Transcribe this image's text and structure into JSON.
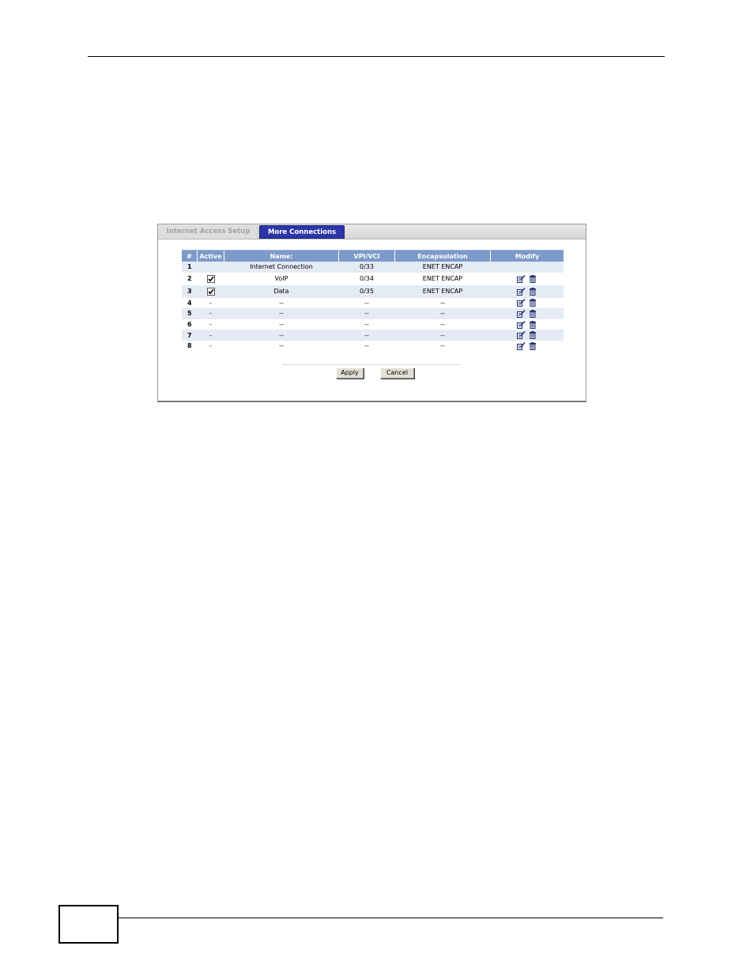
{
  "tabs": [
    {
      "label": "Internet Access Setup",
      "active": false
    },
    {
      "label": "More Connections",
      "active": true
    }
  ],
  "table": {
    "headers": [
      "#",
      "Active",
      "Name:",
      "VPI/VCI",
      "Encapsulation",
      "Modify"
    ],
    "rows": [
      {
        "num": "1",
        "active": "",
        "name": "Internet Connection",
        "vpivci": "0/33",
        "encap": "ENET ENCAP"
      },
      {
        "num": "2",
        "active": "checked",
        "name": "VoIP",
        "vpivci": "0/34",
        "encap": "ENET ENCAP"
      },
      {
        "num": "3",
        "active": "checked",
        "name": "Data",
        "vpivci": "0/35",
        "encap": "ENET ENCAP"
      },
      {
        "num": "4",
        "active": "-",
        "name": "--",
        "vpivci": "--",
        "encap": "--"
      },
      {
        "num": "5",
        "active": "-",
        "name": "--",
        "vpivci": "--",
        "encap": "--"
      },
      {
        "num": "6",
        "active": "-",
        "name": "--",
        "vpivci": "--",
        "encap": "--"
      },
      {
        "num": "7",
        "active": "-",
        "name": "--",
        "vpivci": "--",
        "encap": "--"
      },
      {
        "num": "8",
        "active": "-",
        "name": "--",
        "vpivci": "--",
        "encap": "--"
      }
    ]
  },
  "buttons": {
    "apply": "Apply",
    "cancel": "Cancel"
  },
  "icons": {
    "edit": "edit-icon",
    "delete": "delete-icon"
  },
  "colors": {
    "header_bg": "#7d9bc8",
    "active_tab": "#2d35a8",
    "row_shade": "#e4ebf5"
  }
}
